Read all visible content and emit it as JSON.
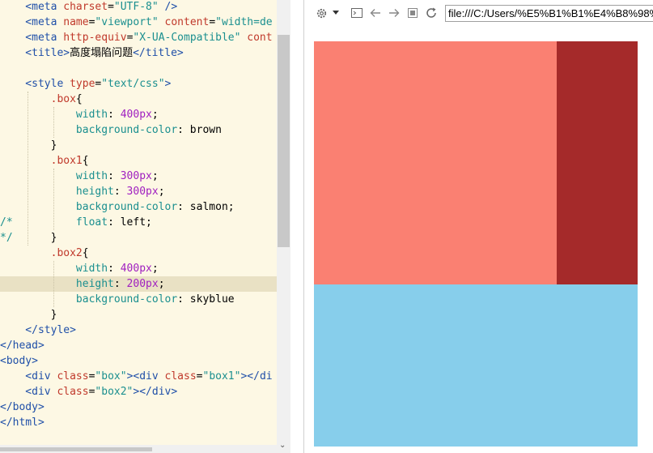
{
  "editor": {
    "lines": [
      [
        [
          "t",
          "    <"
        ],
        [
          "t",
          "meta"
        ],
        [
          "txt",
          " "
        ],
        [
          "a",
          "charset"
        ],
        [
          "txt",
          "="
        ],
        [
          "s",
          "\"UTF-8\""
        ],
        [
          "txt",
          " "
        ],
        [
          "t",
          "/>"
        ]
      ],
      [
        [
          "t",
          "    <"
        ],
        [
          "t",
          "meta"
        ],
        [
          "txt",
          " "
        ],
        [
          "a",
          "name"
        ],
        [
          "txt",
          "="
        ],
        [
          "s",
          "\"viewport\""
        ],
        [
          "txt",
          " "
        ],
        [
          "a",
          "content"
        ],
        [
          "txt",
          "="
        ],
        [
          "s",
          "\"width=de"
        ]
      ],
      [
        [
          "t",
          "    <"
        ],
        [
          "t",
          "meta"
        ],
        [
          "txt",
          " "
        ],
        [
          "a",
          "http-equiv"
        ],
        [
          "txt",
          "="
        ],
        [
          "s",
          "\"X-UA-Compatible\""
        ],
        [
          "txt",
          " "
        ],
        [
          "a",
          "cont"
        ]
      ],
      [
        [
          "t",
          "    <title>"
        ],
        [
          "txt",
          "高度塌陷问题"
        ],
        [
          "t",
          "</title>"
        ]
      ],
      [],
      [
        [
          "t",
          "    <"
        ],
        [
          "t",
          "style"
        ],
        [
          "txt",
          " "
        ],
        [
          "a",
          "type"
        ],
        [
          "txt",
          "="
        ],
        [
          "s",
          "\"text/css\""
        ],
        [
          "t",
          ">"
        ]
      ],
      [
        [
          "sel",
          "        .box"
        ],
        [
          "txt",
          "{"
        ]
      ],
      [
        [
          "p",
          "            width"
        ],
        [
          "txt",
          ": "
        ],
        [
          "n",
          "400"
        ],
        [
          "n",
          "px"
        ],
        [
          "txt",
          ";"
        ]
      ],
      [
        [
          "p",
          "            background-color"
        ],
        [
          "txt",
          ": brown"
        ]
      ],
      [
        [
          "txt",
          "        }"
        ]
      ],
      [
        [
          "sel",
          "        .box1"
        ],
        [
          "txt",
          "{"
        ]
      ],
      [
        [
          "p",
          "            width"
        ],
        [
          "txt",
          ": "
        ],
        [
          "n",
          "300"
        ],
        [
          "n",
          "px"
        ],
        [
          "txt",
          ";"
        ]
      ],
      [
        [
          "p",
          "            height"
        ],
        [
          "txt",
          ": "
        ],
        [
          "n",
          "300"
        ],
        [
          "n",
          "px"
        ],
        [
          "txt",
          ";"
        ]
      ],
      [
        [
          "p",
          "            background-color"
        ],
        [
          "txt",
          ": salmon;"
        ]
      ],
      [
        [
          "c",
          "/*"
        ],
        [
          "p",
          "          float"
        ],
        [
          "txt",
          ": left;"
        ]
      ],
      [
        [
          "c",
          "*/"
        ],
        [
          "txt",
          "      }"
        ]
      ],
      [
        [
          "sel",
          "        .box2"
        ],
        [
          "txt",
          "{"
        ]
      ],
      [
        [
          "p",
          "            width"
        ],
        [
          "txt",
          ": "
        ],
        [
          "n",
          "400"
        ],
        [
          "n",
          "px"
        ],
        [
          "txt",
          ";"
        ]
      ],
      [
        [
          "p",
          "            height"
        ],
        [
          "txt",
          ": "
        ],
        [
          "n",
          "200"
        ],
        [
          "n",
          "px"
        ],
        [
          "txt",
          ";"
        ]
      ],
      [
        [
          "p",
          "            background-color"
        ],
        [
          "txt",
          ": skyblue"
        ]
      ],
      [
        [
          "txt",
          "        }"
        ]
      ],
      [
        [
          "t",
          "    </style>"
        ]
      ],
      [
        [
          "t",
          "</head>"
        ]
      ],
      [
        [
          "t",
          "<body>"
        ]
      ],
      [
        [
          "t",
          "    <div"
        ],
        [
          "txt",
          " "
        ],
        [
          "a",
          "class"
        ],
        [
          "txt",
          "="
        ],
        [
          "s",
          "\"box\""
        ],
        [
          "t",
          "><div"
        ],
        [
          "txt",
          " "
        ],
        [
          "a",
          "class"
        ],
        [
          "txt",
          "="
        ],
        [
          "s",
          "\"box1\""
        ],
        [
          "t",
          "></di"
        ]
      ],
      [
        [
          "t",
          "    <div"
        ],
        [
          "txt",
          " "
        ],
        [
          "a",
          "class"
        ],
        [
          "txt",
          "="
        ],
        [
          "s",
          "\"box2\""
        ],
        [
          "t",
          "></div>"
        ]
      ],
      [
        [
          "t",
          "</body>"
        ]
      ],
      [
        [
          "t",
          "</html>"
        ]
      ]
    ],
    "highlighted_line": 18
  },
  "browser": {
    "address": "file:///C:/Users/%E5%B1%B1%E4%B8%98%",
    "icons": [
      "gear-icon",
      "dropdown-arrow-icon",
      "console-icon",
      "back-icon",
      "forward-icon",
      "stop-icon",
      "reload-icon"
    ]
  },
  "render": {
    "box_color": "#a52a2a",
    "box1_color": "#fa8072",
    "box2_color": "#87ceeb"
  }
}
